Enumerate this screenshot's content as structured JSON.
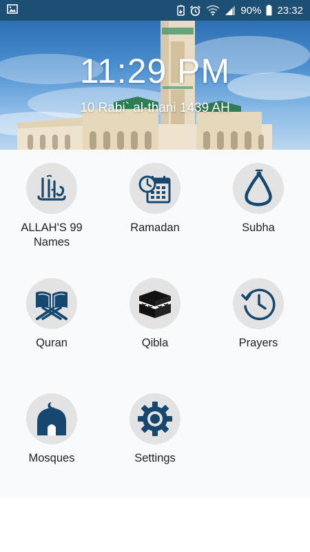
{
  "status_bar": {
    "battery": "90%",
    "time": "23:32",
    "icons": [
      "gallery-icon",
      "battery-saver-icon",
      "alarm-icon",
      "wifi-icon",
      "signal-icon",
      "battery-icon"
    ]
  },
  "header": {
    "clock": "11:29 PM",
    "hijri_date": "10 Rabi` al-thani 1439 AH"
  },
  "colors": {
    "status_bar": "#1d4e74",
    "icon": "#16476e",
    "icon_circle": "#e3e3e3",
    "grid_background": "#f8fafb"
  },
  "menu": {
    "items": [
      {
        "label": "ALLAH'S 99 Names",
        "icon": "allah-calligraphy-icon"
      },
      {
        "label": "Ramadan",
        "icon": "calendar-clock-icon"
      },
      {
        "label": "Subha",
        "icon": "prayer-beads-icon"
      },
      {
        "label": "Quran",
        "icon": "quran-book-icon"
      },
      {
        "label": "Qibla",
        "icon": "kaaba-icon"
      },
      {
        "label": "Prayers",
        "icon": "history-clock-icon"
      },
      {
        "label": "Mosques",
        "icon": "mosque-icon"
      },
      {
        "label": "Settings",
        "icon": "gear-icon"
      }
    ]
  }
}
